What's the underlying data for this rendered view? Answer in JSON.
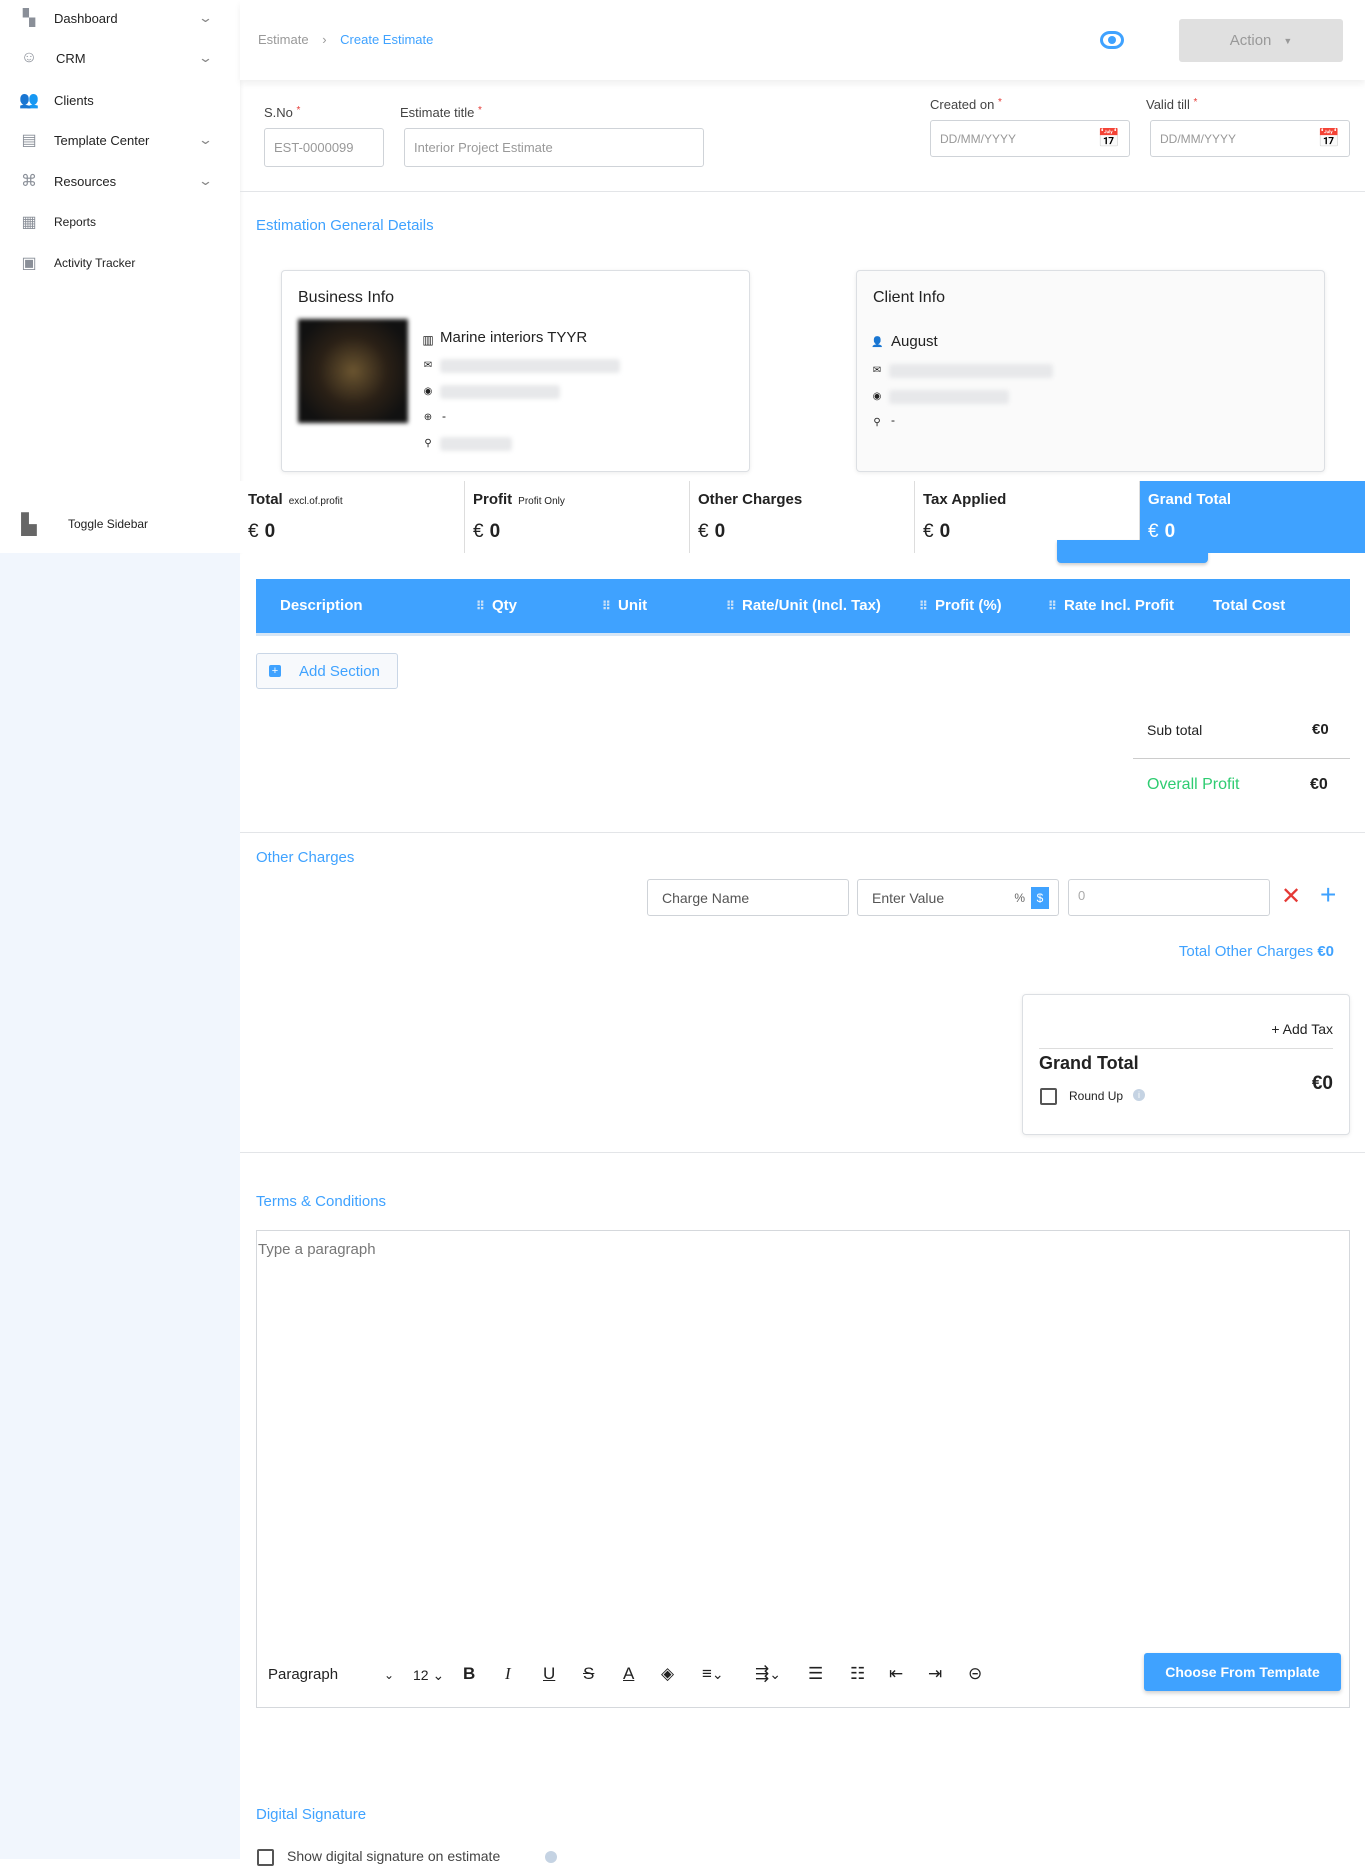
{
  "sidebar": {
    "items": [
      {
        "label": "Dashboard",
        "icon": "dashboard-icon",
        "chevron": true
      },
      {
        "label": "CRM",
        "icon": "crm-icon",
        "chevron": true
      },
      {
        "label": "Clients",
        "icon": "clients-icon",
        "active": true
      },
      {
        "label": "Template Center",
        "icon": "template-icon",
        "chevron": true
      },
      {
        "label": "Resources",
        "icon": "resources-icon",
        "chevron": true
      },
      {
        "label": "Reports",
        "icon": "reports-icon"
      },
      {
        "label": "Activity Tracker",
        "icon": "activity-icon"
      }
    ],
    "toggle": "Toggle Sidebar"
  },
  "header": {
    "breadcrumb": [
      "Estimate",
      "Create Estimate"
    ],
    "action": "Action"
  },
  "form": {
    "sno_label": "S.No",
    "sno_value": "EST-0000099",
    "title_label": "Estimate title",
    "title_placeholder": "Interior Project Estimate",
    "created_label": "Created on",
    "created_placeholder": "DD/MM/YYYY",
    "valid_label": "Valid till",
    "valid_placeholder": "DD/MM/YYYY"
  },
  "general": {
    "heading": "Estimation General Details",
    "business": {
      "title": "Business Info",
      "name": "Marine interiors TYYR",
      "website": "-"
    },
    "client": {
      "title": "Client Info",
      "name": "August",
      "address": "-"
    }
  },
  "summary": [
    {
      "label": "Total",
      "sub": "excl.of.profit",
      "currency": "€",
      "value": "0"
    },
    {
      "label": "Profit",
      "sub": "Profit Only",
      "currency": "€",
      "value": "0"
    },
    {
      "label": "Other Charges",
      "sub": "",
      "currency": "€",
      "value": "0"
    },
    {
      "label": "Tax Applied",
      "sub": "",
      "currency": "€",
      "value": "0"
    },
    {
      "label": "Grand Total",
      "sub": "",
      "currency": "€",
      "value": "0"
    }
  ],
  "table": {
    "columns": [
      "Description",
      "Qty",
      "Unit",
      "Rate/Unit (Incl. Tax)",
      "Profit (%)",
      "Rate Incl. Profit",
      "Total Cost"
    ],
    "add_section": "Add Section"
  },
  "totals": {
    "subtotal_label": "Sub total",
    "subtotal": "€0",
    "profit_label": "Overall Profit",
    "profit": "€0"
  },
  "other": {
    "heading": "Other Charges",
    "name_placeholder": "Charge Name",
    "value_placeholder": "Enter Value",
    "percent": "%",
    "dollar": "$",
    "amount_placeholder": "0",
    "total_label": "Total Other Charges",
    "total": "€0"
  },
  "grand": {
    "add_tax": "+ Add Tax",
    "label": "Grand Total",
    "value": "€0",
    "round_up": "Round Up"
  },
  "terms": {
    "heading": "Terms & Conditions",
    "placeholder": "Type a paragraph",
    "block": "Paragraph",
    "size": "12",
    "template_btn": "Choose From Template"
  },
  "signature": {
    "heading": "Digital Signature",
    "checkbox": "Show digital signature on estimate"
  },
  "colors": {
    "accent": "#3fa2ff",
    "danger": "#e53935",
    "profit": "#2ecc71"
  }
}
